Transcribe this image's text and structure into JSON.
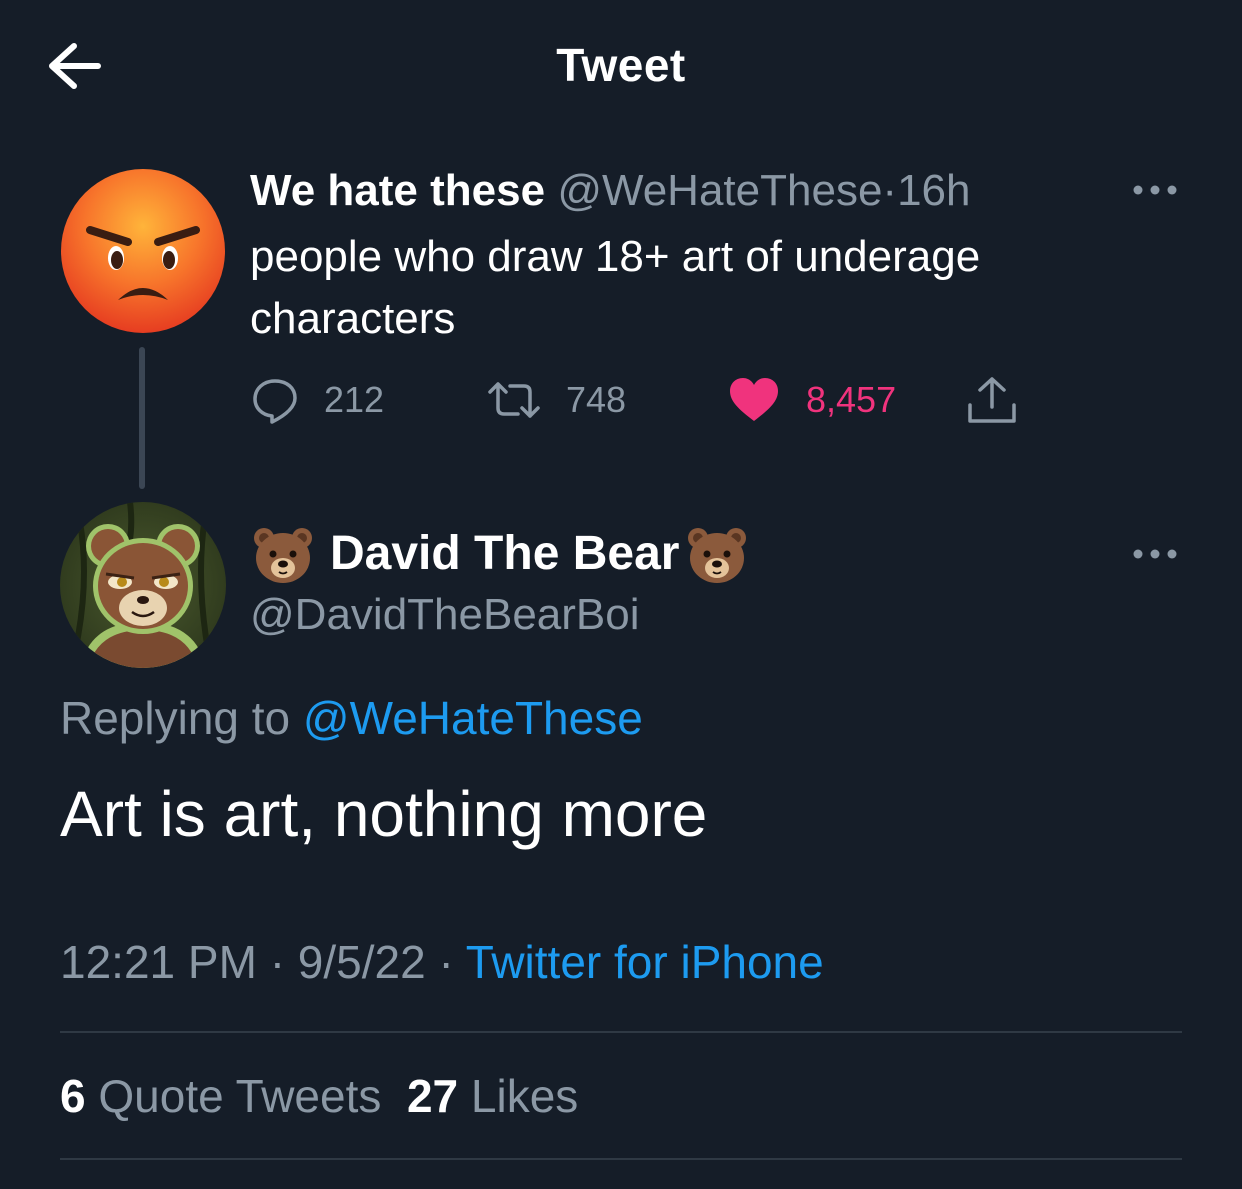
{
  "header": {
    "title": "Tweet"
  },
  "parent_tweet": {
    "name": "We hate these",
    "handle": "@WeHateThese",
    "separator": "·",
    "time": "16h",
    "text": "people who draw 18+ art of underage characters",
    "replies": "212",
    "retweets": "748",
    "likes": "8,457",
    "avatar_icon": "angry-face-emoji"
  },
  "reply_tweet": {
    "name": "David The Bear",
    "handle": "@DavidTheBearBoi",
    "replying_prefix": "Replying to",
    "replying_to": "@WeHateThese",
    "text": "Art is art, nothing more",
    "time": "12:21 PM",
    "date": "9/5/22",
    "separator": "·",
    "source": "Twitter for iPhone",
    "name_icon": "bear-face-emoji"
  },
  "stats": {
    "quote_count": "6",
    "quote_label": "Quote Tweets",
    "like_count": "27",
    "like_label": "Likes"
  },
  "colors": {
    "background": "#151d28",
    "muted": "#8b98a5",
    "link": "#1d9bf0",
    "like": "#f0337d"
  }
}
